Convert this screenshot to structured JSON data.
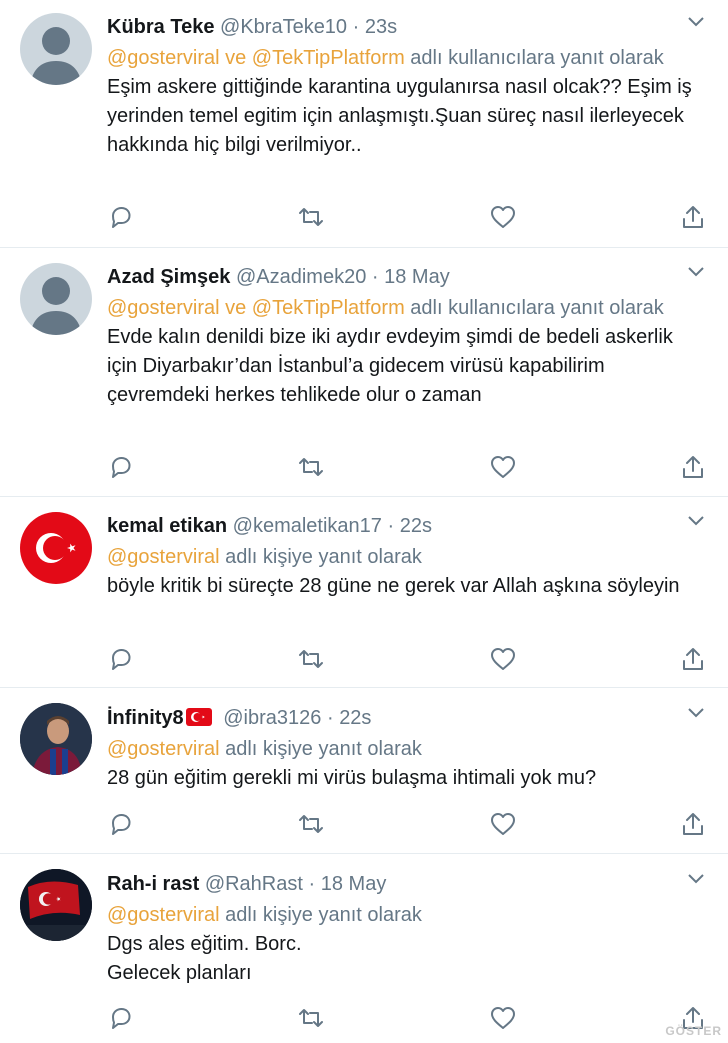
{
  "colors": {
    "mention": "#e8a33b",
    "muted": "#657786",
    "text": "#14171a",
    "divider": "#e6ecf0"
  },
  "reply_prefix": "",
  "tweets": [
    {
      "name": "Kübra Teke",
      "handle": "@KbraTeke10",
      "sep": "·",
      "time": "23s",
      "reply_mentions": "@gosterviral ve @TekTipPlatform",
      "reply_suffix": " adlı kullanıcılara yanıt olarak",
      "text": "Eşim askere gittiğinde karantina uygulanırsa nasıl olcak?? Eşim iş yerinden temel egitim  için anlaşmıştı.Şuan süreç nasıl ilerleyecek hakkında hiç bilgi verilmiyor..",
      "avatar_icon": "default-avatar-icon"
    },
    {
      "name": "Azad Şimşek",
      "handle": "@Azadimek20",
      "sep": "·",
      "time": "18 May",
      "reply_mentions": "@gosterviral ve @TekTipPlatform",
      "reply_suffix": " adlı kullanıcılara yanıt olarak",
      "text": "Evde kalın denildi bize iki aydır evdeyim şimdi de bedeli askerlik için Diyarbakır’dan İstanbul’a gidecem virüsü kapabilirim çevremdeki herkes tehlikede olur o zaman",
      "avatar_icon": "default-avatar-icon"
    },
    {
      "name": "kemal etikan",
      "handle": "@kemaletikan17",
      "sep": "·",
      "time": "22s",
      "reply_mentions": "@gosterviral",
      "reply_suffix": " adlı kişiye yanıt olarak",
      "text": "böyle kritik bi süreçte 28 güne ne gerek var Allah aşkına söyleyin",
      "avatar_icon": "turkish-flag-avatar-icon"
    },
    {
      "name": "İnfinity8",
      "handle": "@ibra3126",
      "sep": "·",
      "time": "22s",
      "reply_mentions": "@gosterviral",
      "reply_suffix": " adlı kişiye yanıt olarak",
      "text": "28 gün eğitim gerekli mi virüs bulaşma ihtimali yok mu?",
      "avatar_icon": "football-player-avatar-icon"
    },
    {
      "name": "Rah-i rast",
      "handle": "@RahRast",
      "sep": "·",
      "time": "18 May",
      "reply_mentions": "@gosterviral",
      "reply_suffix": " adlı kişiye yanıt olarak",
      "text": "Dgs ales eğitim. Borc.\nGelecek planları",
      "avatar_icon": "flag-photo-avatar-icon"
    }
  ],
  "watermark": "GÖSTER"
}
